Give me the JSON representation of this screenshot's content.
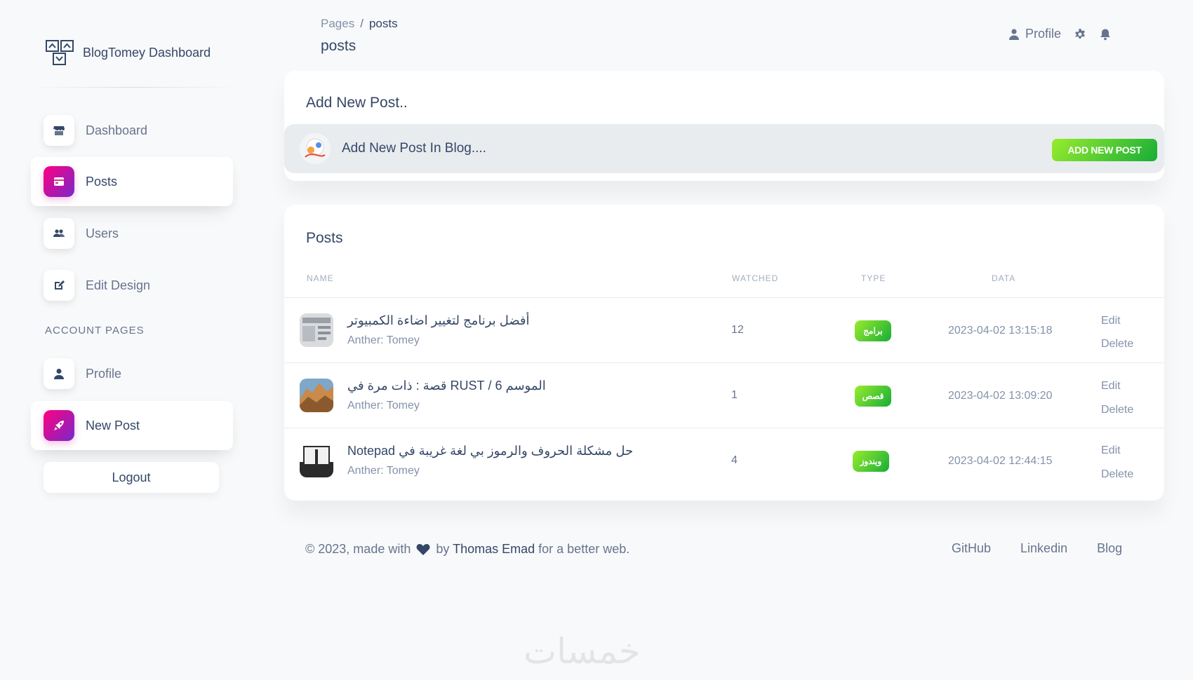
{
  "brand": {
    "name": "BlogTomey Dashboard"
  },
  "sidebar": {
    "items": [
      {
        "label": "Dashboard",
        "icon": "shop-icon"
      },
      {
        "label": "Posts",
        "icon": "posts-icon"
      },
      {
        "label": "Users",
        "icon": "users-icon"
      },
      {
        "label": "Edit Design",
        "icon": "edit-icon"
      }
    ],
    "section_label": "ACCOUNT PAGES",
    "account_items": [
      {
        "label": "Profile",
        "icon": "person-icon"
      },
      {
        "label": "New Post",
        "icon": "rocket-icon"
      }
    ],
    "logout_label": "Logout"
  },
  "breadcrumb": {
    "root": "Pages",
    "separator": "/",
    "current": "posts"
  },
  "page_title": "posts",
  "topnav": {
    "profile_label": "Profile"
  },
  "add_post": {
    "title": "Add New Post..",
    "prompt": "Add New Post In Blog....",
    "button_label": "ADD NEW POST"
  },
  "posts": {
    "title": "Posts",
    "columns": {
      "name": "NAME",
      "watched": "WATCHED",
      "type": "TYPE",
      "data": "DATA"
    },
    "rows": [
      {
        "title": "أفضل برنامج لتغيير اضاءة الكمبيوتر",
        "author": "Anther: Tomey",
        "watched": "12",
        "type": "برامج",
        "date": "2023-04-02 13:15:18",
        "edit": "Edit",
        "delete": "Delete"
      },
      {
        "title": "الموسم 6 / RUST قصة : ذات مرة في",
        "author": "Anther: Tomey",
        "watched": "1",
        "type": "قصص",
        "date": "2023-04-02 13:09:20",
        "edit": "Edit",
        "delete": "Delete"
      },
      {
        "title": "حل مشكلة الحروف والرموز بي لغة غريبة في Notepad",
        "author": "Anther: Tomey",
        "watched": "4",
        "type": "ويندوز",
        "date": "2023-04-02 12:44:15",
        "edit": "Edit",
        "delete": "Delete"
      }
    ]
  },
  "footer": {
    "prefix": "© 2023, made with",
    "by": "by",
    "author": "Thomas Emad",
    "suffix": "for a better web.",
    "links": [
      "GitHub",
      "Linkedin",
      "Blog"
    ]
  },
  "watermark": "خمسات",
  "colors": {
    "accent_gradient_start": "#7928ca",
    "accent_gradient_end": "#ff0080",
    "success_start": "#17ad37",
    "success_end": "#98ec2d"
  }
}
